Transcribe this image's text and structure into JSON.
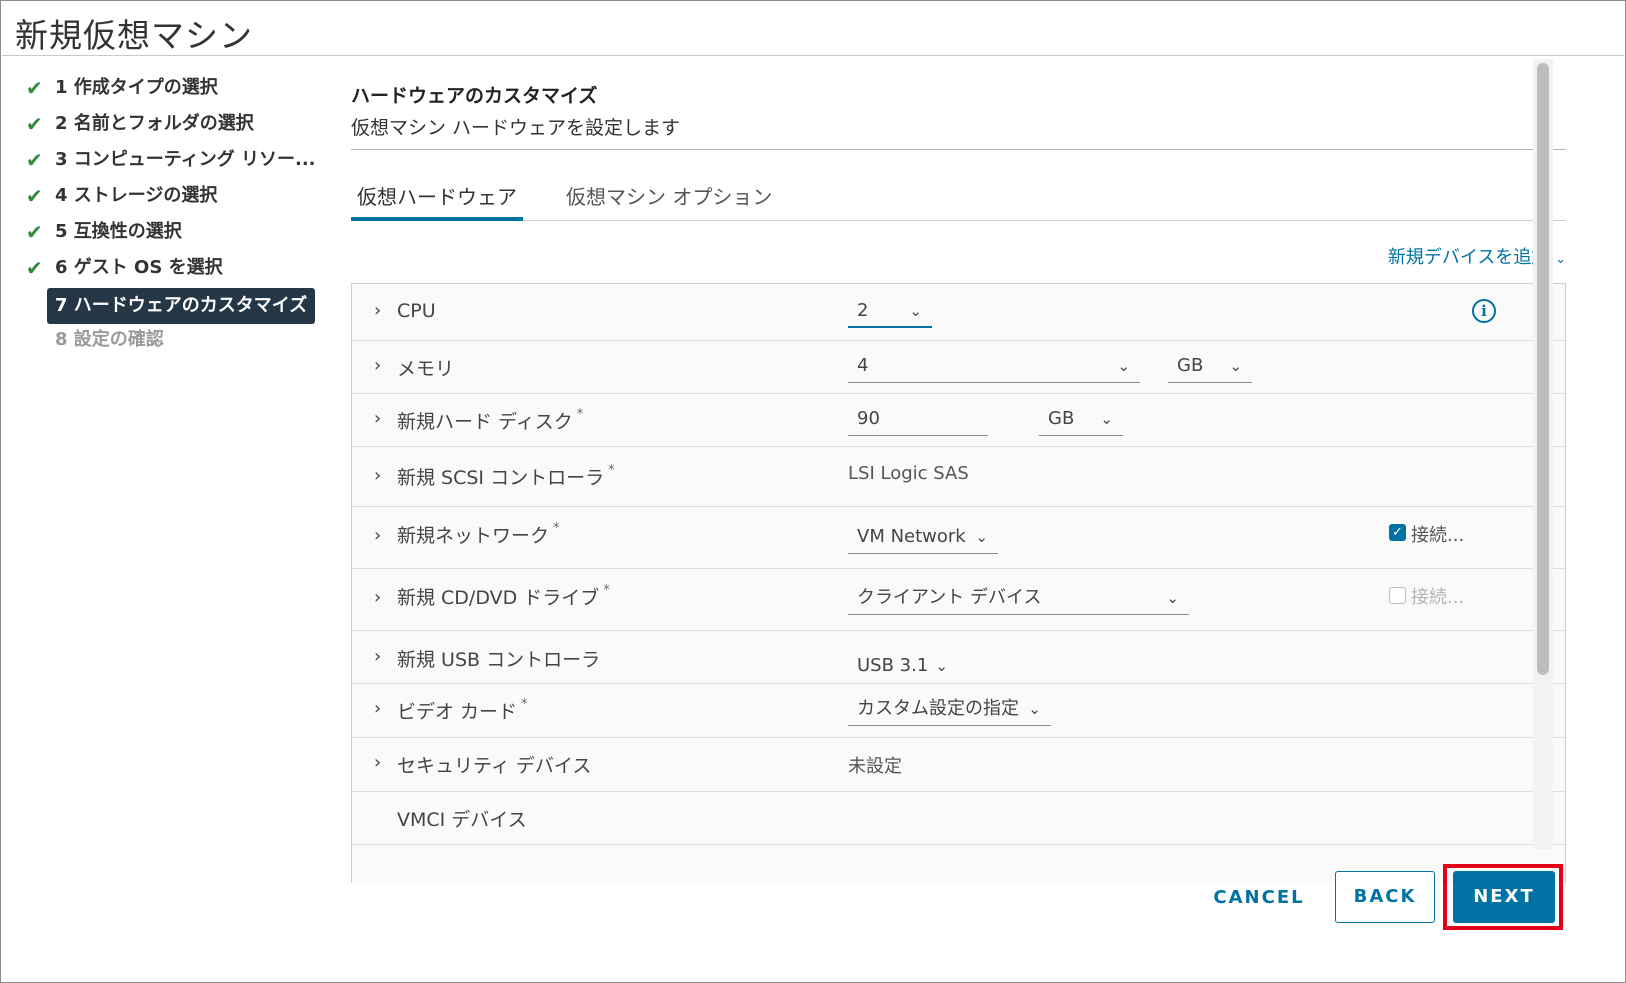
{
  "window": {
    "title": "新規仮想マシン"
  },
  "steps": [
    {
      "label": "1 作成タイプの選択",
      "state": "done"
    },
    {
      "label": "2 名前とフォルダの選択",
      "state": "done"
    },
    {
      "label": "3 コンピューティング リソー...",
      "state": "done"
    },
    {
      "label": "4 ストレージの選択",
      "state": "done"
    },
    {
      "label": "5 互換性の選択",
      "state": "done"
    },
    {
      "label": "6 ゲスト OS を選択",
      "state": "done"
    },
    {
      "label": "7 ハードウェアのカスタマイズ",
      "state": "active"
    },
    {
      "label": "8 設定の確認",
      "state": "disabled"
    }
  ],
  "header": {
    "title": "ハードウェアのカスタマイズ",
    "subtitle": "仮想マシン ハードウェアを設定します"
  },
  "tabs": [
    {
      "label": "仮想ハードウェア",
      "selected": true
    },
    {
      "label": "仮想マシン オプション",
      "selected": false
    }
  ],
  "add_device": "新規デバイスを追加",
  "hardware": {
    "cpu": {
      "label": "CPU",
      "value": "2"
    },
    "memory": {
      "label": "メモリ",
      "value": "4",
      "unit": "GB"
    },
    "disk": {
      "label": "新規ハード ディスク",
      "value": "90",
      "unit": "GB"
    },
    "scsi": {
      "label": "新規 SCSI コントローラ",
      "value": "LSI Logic SAS"
    },
    "network": {
      "label": "新規ネットワーク",
      "value": "VM Network",
      "connect_label": "接続...",
      "connected": true
    },
    "cddvd": {
      "label": "新規 CD/DVD ドライブ",
      "value": "クライアント デバイス",
      "connect_label": "接続...",
      "connected": false
    },
    "usb": {
      "label": "新規 USB コントローラ",
      "value": "USB 3.1"
    },
    "video": {
      "label": "ビデオ カード",
      "value": "カスタム設定の指定"
    },
    "security": {
      "label": "セキュリティ デバイス",
      "value": "未設定"
    },
    "vmci": {
      "label": "VMCI デバイス"
    }
  },
  "required_mark": "*",
  "info_glyph": "i",
  "footer": {
    "cancel": "CANCEL",
    "back": "BACK",
    "next": "NEXT"
  },
  "colors": {
    "accent": "#0072a3",
    "active_step_bg": "#253746",
    "check": "#2e8a3a",
    "highlight": "#e3001b"
  }
}
